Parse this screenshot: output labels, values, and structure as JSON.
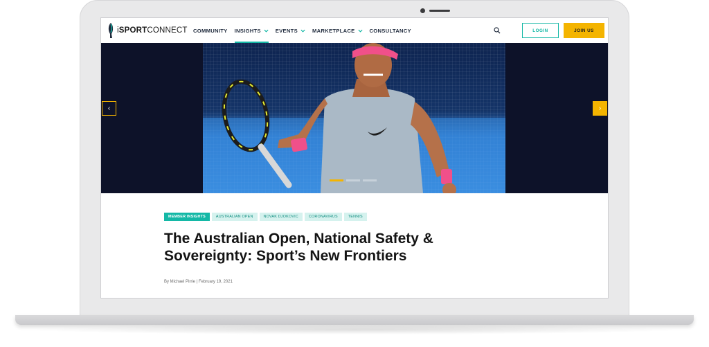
{
  "brand": {
    "logo_prefix": "i",
    "logo_bold": "SPORT",
    "logo_rest": "CONNECT"
  },
  "nav": {
    "items": [
      {
        "label": "COMMUNITY",
        "has_dropdown": false,
        "active": false
      },
      {
        "label": "INSIGHTS",
        "has_dropdown": true,
        "active": true
      },
      {
        "label": "EVENTS",
        "has_dropdown": true,
        "active": false
      },
      {
        "label": "MARKETPLACE",
        "has_dropdown": true,
        "active": false
      },
      {
        "label": "CONSULTANCY",
        "has_dropdown": false,
        "active": false
      }
    ],
    "search_icon": "search-icon",
    "login_label": "LOGIN",
    "join_label": "JOIN US"
  },
  "hero": {
    "image": "tennis player celebrating with racket",
    "prev_icon": "chevron-left-icon",
    "next_icon": "chevron-right-icon",
    "prev_glyph": "‹",
    "next_glyph": "›",
    "slides_total": 3,
    "active_slide": 1
  },
  "article": {
    "tags": [
      "MEMBER INSIGHTS",
      "AUSTRALIAN OPEN",
      "NOVAK DJOKOVIC",
      "CORONAVIRUS",
      "TENNIS"
    ],
    "title": "The Australian Open, National Safety & Sovereignty: Sport’s New Frontiers",
    "byline": "By Michael Pirrie | February 19, 2021"
  },
  "colors": {
    "accent": "#14b8a6",
    "cta": "#f4b400",
    "hero_bg": "#0d1229"
  }
}
